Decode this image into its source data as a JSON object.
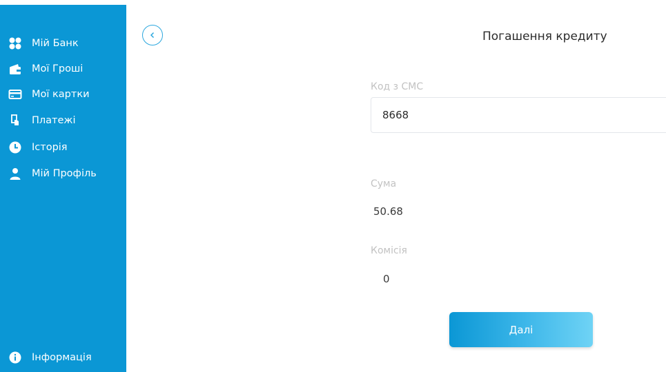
{
  "sidebar": {
    "items": [
      {
        "label": "Мій Банк",
        "icon": "dashboard-icon"
      },
      {
        "label": "Мої Гроші",
        "icon": "wallet-icon"
      },
      {
        "label": "Мої картки",
        "icon": "credit-card-icon"
      },
      {
        "label": "Платежі",
        "icon": "payment-hand-icon"
      },
      {
        "label": "Історія",
        "icon": "clock-icon"
      },
      {
        "label": "Мій Профіль",
        "icon": "user-icon"
      }
    ],
    "footer": {
      "label": "Інформація",
      "icon": "info-icon"
    }
  },
  "header": {
    "title": "Погашення кредиту"
  },
  "form": {
    "sms_label": "Код з СМС",
    "sms_value": "8668",
    "amount_label": "Сума",
    "amount_value": "50.68",
    "fee_label": "Комісія",
    "fee_value": "0"
  },
  "actions": {
    "next_label": "Далі"
  },
  "colors": {
    "sidebar": "#0b97d5",
    "accent": "#2ba7de",
    "label": "#c2c2c2"
  }
}
